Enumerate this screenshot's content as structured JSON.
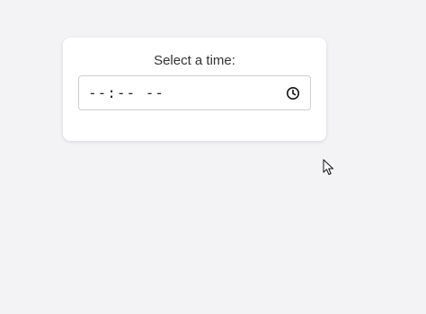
{
  "form": {
    "label": "Select a time:",
    "time_value": "--:-- --"
  },
  "icons": {
    "time_picker": "clock-icon",
    "pointer": "mouse-cursor-icon"
  },
  "colors": {
    "background": "#f3f3f6",
    "card": "#ffffff",
    "text": "#333333",
    "input_border": "#cfcfcf"
  }
}
